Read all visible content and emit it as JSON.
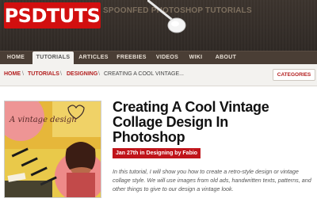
{
  "header": {
    "logo": "PSDTUTS",
    "tagline": "SPOONFED PHOTOSHOP TUTORIALS",
    "brand_color": "#d20f0f"
  },
  "nav": {
    "items": [
      {
        "label": "HOME"
      },
      {
        "label": "TUTORIALS",
        "active": true
      },
      {
        "label": "ARTICLES"
      },
      {
        "label": "FREEBIES"
      },
      {
        "label": "VIDEOS"
      },
      {
        "label": "WIKI"
      },
      {
        "label": "ABOUT"
      }
    ]
  },
  "breadcrumb": {
    "items": [
      "HOME",
      "TUTORIALS",
      "DESIGNING"
    ],
    "separator": "\\",
    "current": "CREATING A COOL VINTAGE...",
    "categories_button": "CATEGORIES"
  },
  "article": {
    "title_lines": [
      "Creating A Cool Vintage",
      "Collage Design In",
      "Photoshop"
    ],
    "meta": "Jan 27th in Designing by Fabio",
    "excerpt": "In this tutorial, I will show you how to create a retro-style design or vintage collage style. We will use images from old ads, handwritten texts, patterns, and other things to give to our design a vintage look.",
    "thumbnail_text": "A vintage design",
    "thumbnail_icon": "collage-thumbnail"
  }
}
